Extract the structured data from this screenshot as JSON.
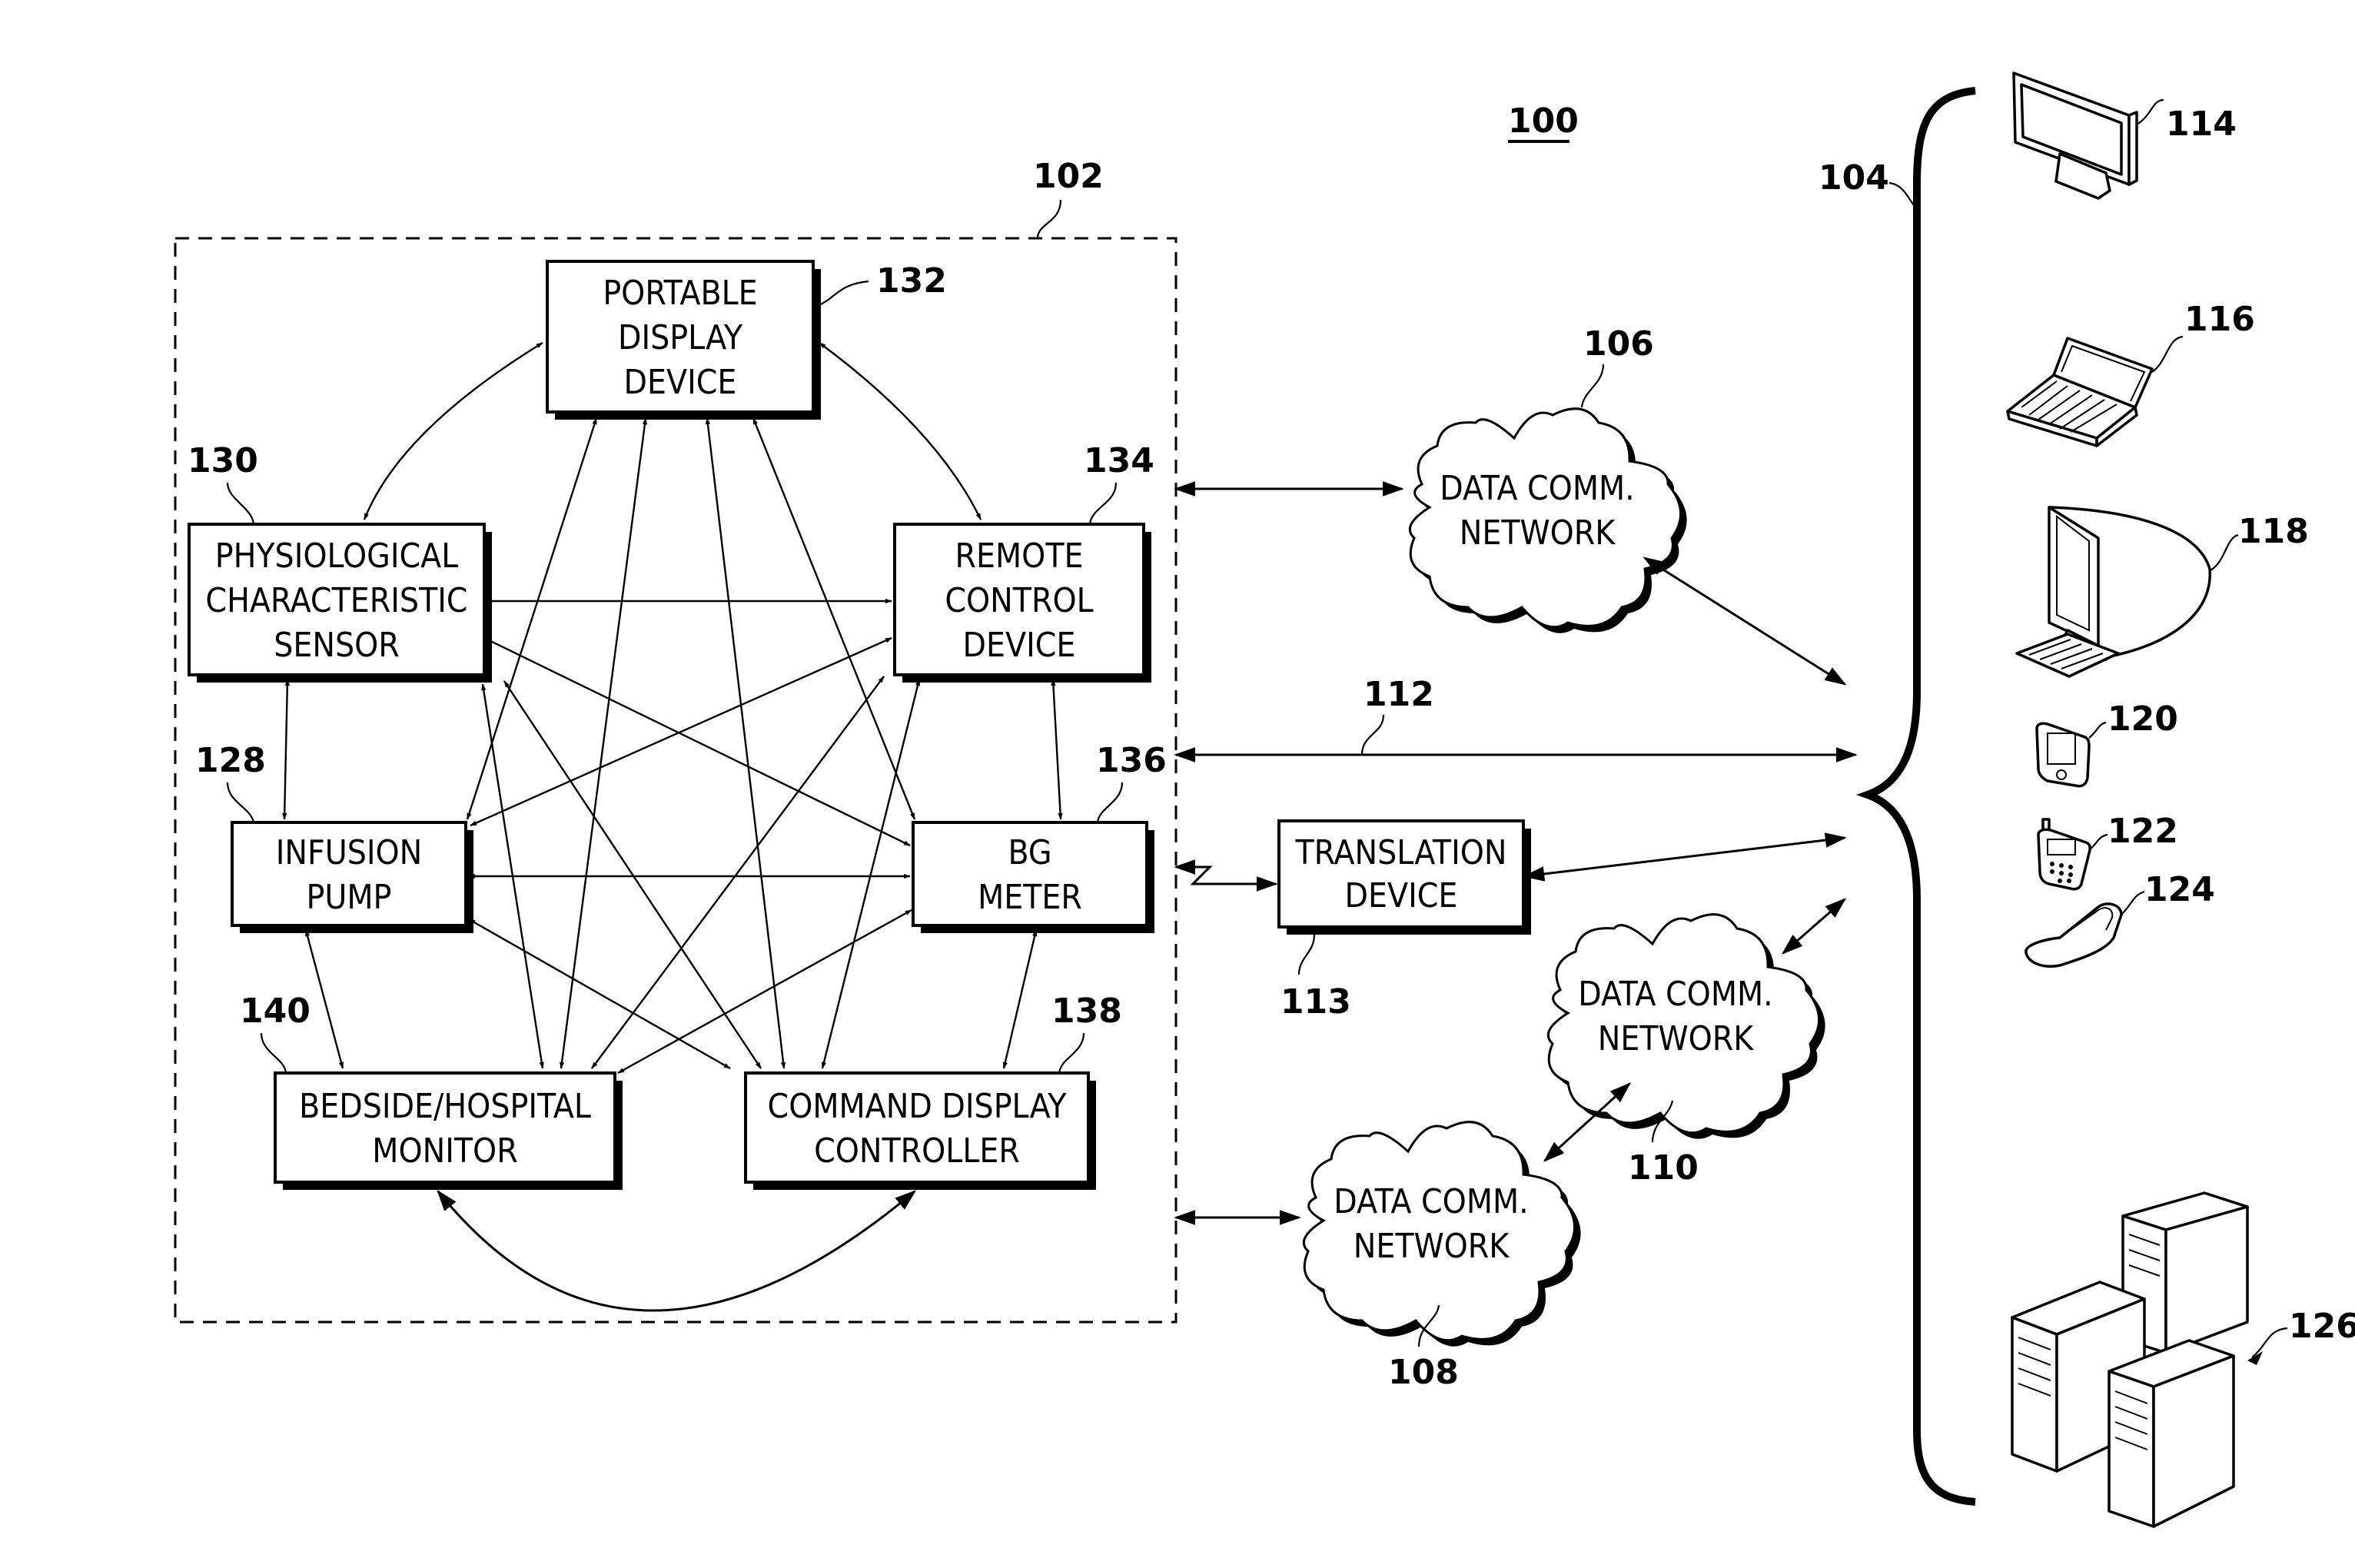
{
  "figure": {
    "system_ref": "100",
    "local_group_ref": "102",
    "remote_group_ref": "104"
  },
  "local_devices": [
    {
      "ref": "132",
      "lines": [
        "PORTABLE",
        "DISPLAY",
        "DEVICE"
      ]
    },
    {
      "ref": "130",
      "lines": [
        "PHYSIOLOGICAL",
        "CHARACTERISTIC",
        "SENSOR"
      ]
    },
    {
      "ref": "134",
      "lines": [
        "REMOTE",
        "CONTROL",
        "DEVICE"
      ]
    },
    {
      "ref": "128",
      "lines": [
        "INFUSION",
        "PUMP"
      ]
    },
    {
      "ref": "136",
      "lines": [
        "BG",
        "METER"
      ]
    },
    {
      "ref": "140",
      "lines": [
        "BEDSIDE/HOSPITAL",
        "MONITOR"
      ]
    },
    {
      "ref": "138",
      "lines": [
        "COMMAND DISPLAY",
        "CONTROLLER"
      ]
    }
  ],
  "networks": [
    {
      "ref": "106",
      "lines": [
        "DATA COMM.",
        "NETWORK"
      ]
    },
    {
      "ref": "110",
      "lines": [
        "DATA COMM.",
        "NETWORK"
      ]
    },
    {
      "ref": "108",
      "lines": [
        "DATA COMM.",
        "NETWORK"
      ]
    }
  ],
  "direct_link": {
    "ref": "112"
  },
  "translation_device": {
    "ref": "113",
    "lines": [
      "TRANSLATION",
      "DEVICE"
    ]
  },
  "remote_devices": [
    {
      "ref": "114",
      "icon": "flat-panel-monitor-icon"
    },
    {
      "ref": "116",
      "icon": "laptop-icon"
    },
    {
      "ref": "118",
      "icon": "desktop-computer-icon"
    },
    {
      "ref": "120",
      "icon": "pda-icon"
    },
    {
      "ref": "122",
      "icon": "cell-phone-icon"
    },
    {
      "ref": "124",
      "icon": "flip-phone-icon"
    },
    {
      "ref": "126",
      "icon": "server-rack-icon"
    }
  ]
}
